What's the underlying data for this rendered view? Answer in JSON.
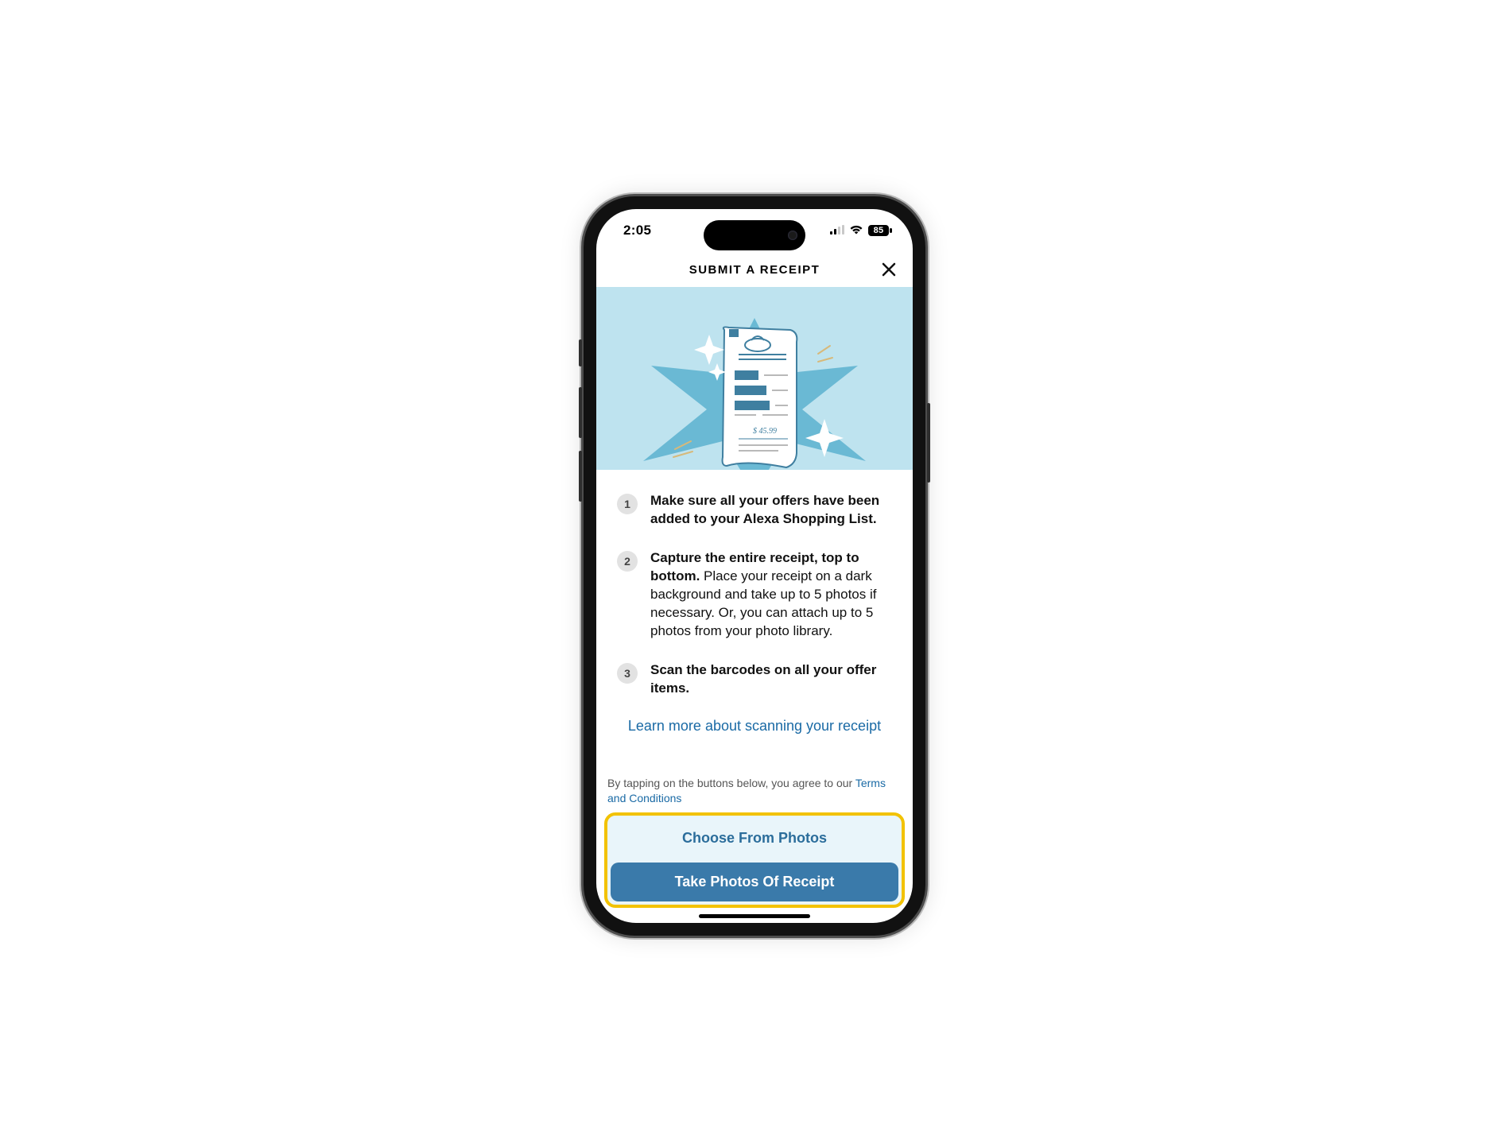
{
  "status": {
    "time": "2:05",
    "battery": "85"
  },
  "nav": {
    "title": "SUBMIT A RECEIPT"
  },
  "hero": {
    "receipt_total": "$ 45.99"
  },
  "steps": [
    {
      "num": "1",
      "bold": "Make sure all your offers have been added to your Alexa Shopping List.",
      "rest": ""
    },
    {
      "num": "2",
      "bold": "Capture the entire receipt, top to bottom.",
      "rest": " Place your receipt on a dark background and take up to 5 photos if necessary. Or, you can attach up to 5 photos from your photo library."
    },
    {
      "num": "3",
      "bold": "Scan the barcodes on all your offer items.",
      "rest": ""
    }
  ],
  "learn_more": "Learn more about scanning your receipt",
  "agree_prefix": "By tapping on the buttons below, you agree to our ",
  "agree_link": "Terms and Conditions",
  "buttons": {
    "choose": "Choose From Photos",
    "take": "Take Photos Of Receipt"
  }
}
